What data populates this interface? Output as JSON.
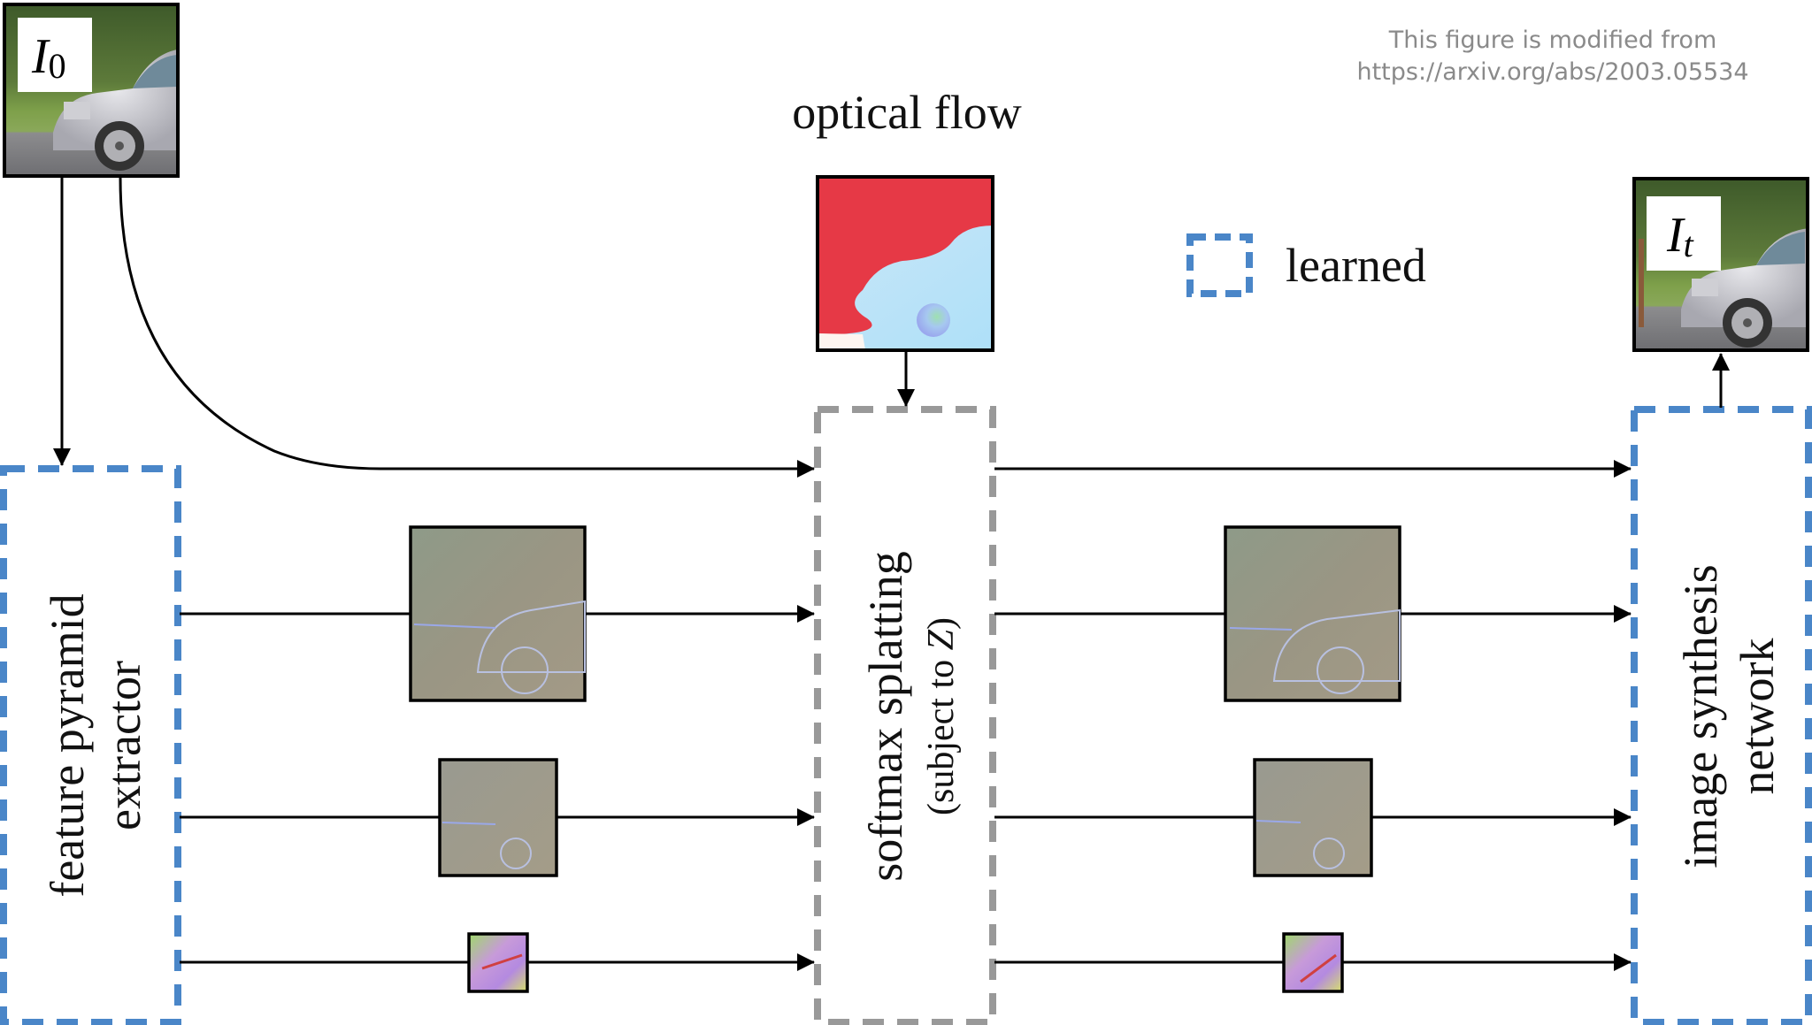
{
  "credit": {
    "line1": "This figure is modified from",
    "line2": "https://arxiv.org/abs/2003.05534"
  },
  "title_optical_flow": "optical flow",
  "legend": {
    "label": "learned",
    "swatch": "dashed-blue-box",
    "color": "#4a86c8"
  },
  "colors": {
    "learned": "#4a86c8",
    "non_learned": "#999999",
    "arrow": "#000000",
    "flow_red": "#e63946",
    "flow_blue": "#b6e3f7",
    "feature_base": "#9a9a88"
  },
  "inputs": {
    "input_frame": {
      "symbol": "I",
      "subscript": "0",
      "image": "car-photo"
    },
    "output_frame": {
      "symbol": "I",
      "subscript": "t",
      "image": "car-photo-interpolated"
    }
  },
  "blocks": {
    "feature_extractor": {
      "line1": "feature pyramid",
      "line2": "extractor",
      "learned": true
    },
    "softmax_splatting": {
      "line1": "softmax splatting",
      "line2_prefix": "(subject to ",
      "line2_math": "Z",
      "line2_suffix": ")",
      "learned": false
    },
    "synthesis_network": {
      "line1": "image synthesis",
      "line2": "network",
      "learned": true
    }
  },
  "pyramid_levels": [
    {
      "level": 1,
      "name": "full-resolution-features"
    },
    {
      "level": 2,
      "name": "half-resolution-features"
    },
    {
      "level": 3,
      "name": "quarter-resolution-features"
    }
  ]
}
